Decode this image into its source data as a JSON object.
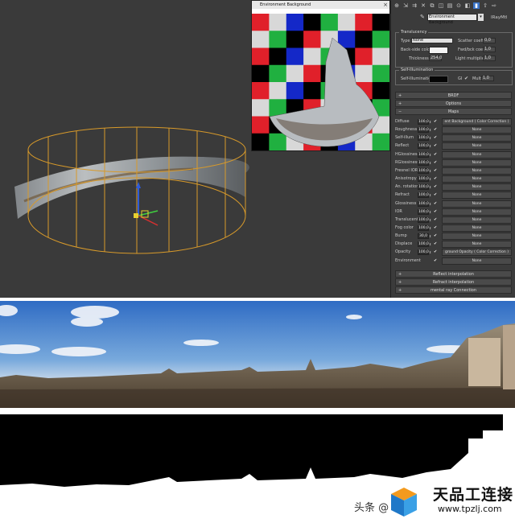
{
  "preview_window": {
    "title": "Environment Background"
  },
  "toolbar": {
    "material_name": "Environment Background",
    "material_type": "IRayMtl"
  },
  "translucency": {
    "group_title": "Translucency",
    "type_label": "Type",
    "type_value": "None",
    "backside_label": "Back-side color",
    "thickness_label": "Thickness",
    "thickness_value": "254,0",
    "scatter_label": "Scatter coeff",
    "scatter_value": "0,0",
    "fwdbck_label": "Fwd/bck coeff",
    "fwdbck_value": "1,0",
    "light_mult_label": "Light multiplier",
    "light_mult_value": "1,0"
  },
  "self_illum": {
    "group_title": "Self-Illumination",
    "label": "Self-Illumination",
    "gi_label": "GI",
    "mult_label": "Mult",
    "mult_value": "1,0"
  },
  "rollouts": {
    "brdf": "BRDF",
    "options": "Options",
    "maps": "Maps",
    "reflect_interp": "Reflect interpolation",
    "refract_interp": "Refract interpolation",
    "mental_ray": "mental ray Connection"
  },
  "maps": [
    {
      "name": "Diffuse",
      "value": "100,0",
      "map": "ent Background  ( Color Correction )"
    },
    {
      "name": "Roughness",
      "value": "100,0",
      "map": "None"
    },
    {
      "name": "Self-illum",
      "value": "100,0",
      "map": "None"
    },
    {
      "name": "Reflect",
      "value": "100,0",
      "map": "None"
    },
    {
      "name": "HGlossiness",
      "value": "100,0",
      "map": "None"
    },
    {
      "name": "RGlossiness",
      "value": "100,0",
      "map": "None"
    },
    {
      "name": "Fresnel IOR",
      "value": "100,0",
      "map": "None"
    },
    {
      "name": "Anisotropy",
      "value": "100,0",
      "map": "None"
    },
    {
      "name": "An. rotation",
      "value": "100,0",
      "map": "None"
    },
    {
      "name": "Refract",
      "value": "100,0",
      "map": "None"
    },
    {
      "name": "Glossiness",
      "value": "100,0",
      "map": "None"
    },
    {
      "name": "IOR",
      "value": "100,0",
      "map": "None"
    },
    {
      "name": "Translucent",
      "value": "100,0",
      "map": "None"
    },
    {
      "name": "Fog color",
      "value": "100,0",
      "map": "None"
    },
    {
      "name": "Bump",
      "value": "30,0",
      "map": "None"
    },
    {
      "name": "Displace",
      "value": "100,0",
      "map": "None"
    },
    {
      "name": "Opacity",
      "value": "100,0",
      "map": "ground Opacity  ( Color Correction )"
    },
    {
      "name": "Environment",
      "value": "",
      "map": "None"
    }
  ],
  "watermark": {
    "brand": "天品工连接",
    "url": "www.tpzlj.com",
    "toutiao": "头条 @"
  }
}
